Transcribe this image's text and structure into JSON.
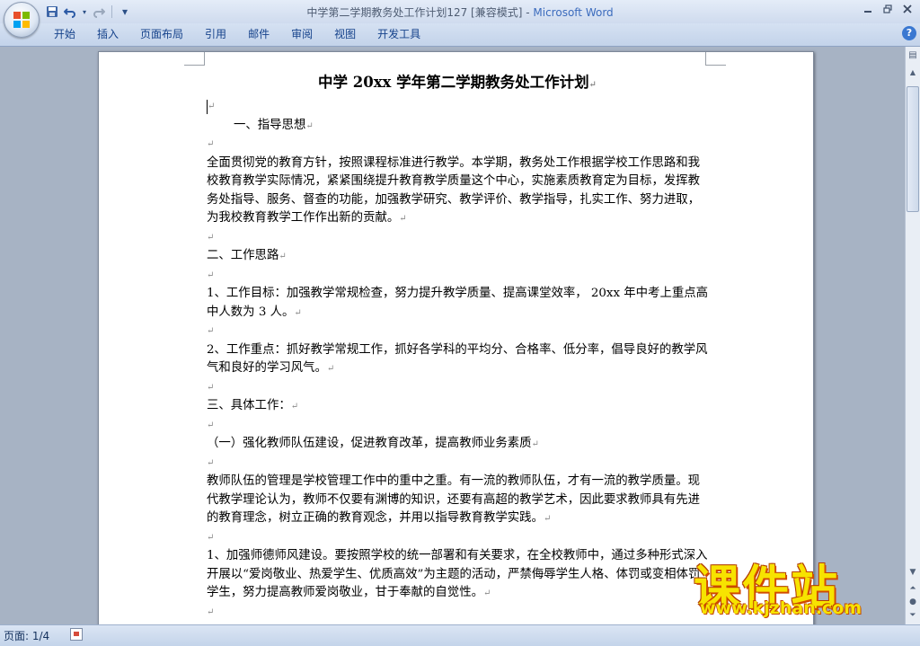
{
  "window": {
    "title_doc": "中学第二学期教务处工作计划127 [兼容模式]",
    "title_sep": " - ",
    "title_app": "Microsoft Word"
  },
  "quick_access": {
    "icons": [
      "save-icon",
      "undo-icon",
      "redo-icon",
      "customize-icon"
    ],
    "customize_glyph": "▾"
  },
  "ribbon": {
    "tabs": [
      "开始",
      "插入",
      "页面布局",
      "引用",
      "邮件",
      "审阅",
      "视图",
      "开发工具"
    ],
    "help_label": "?"
  },
  "document": {
    "title": "中学 20xx 学年第二学期教务处工作计划",
    "paragraph_mark": "↵",
    "paragraphs": [
      {
        "type": "cursor",
        "text": ""
      },
      {
        "type": "text",
        "indent": true,
        "text": "一、指导思想"
      },
      {
        "type": "empty",
        "text": ""
      },
      {
        "type": "text",
        "indent": false,
        "text": "全面贯彻党的教育方针，按照课程标准进行教学。本学期，教务处工作根据学校工作思路和我校教育教学实际情况，紧紧围绕提升教育教学质量这个中心，实施素质教育定为目标，发挥教务处指导、服务、督查的功能，加强教学研究、教学评价、教学指导，扎实工作、努力进取，为我校教育教学工作作出新的贡献。"
      },
      {
        "type": "empty",
        "text": ""
      },
      {
        "type": "text",
        "indent": false,
        "text": "二、工作思路"
      },
      {
        "type": "empty",
        "text": ""
      },
      {
        "type": "text",
        "indent": false,
        "text": "1、工作目标：加强教学常规检查，努力提升教学质量、提高课堂效率， 20xx 年中考上重点高中人数为 3 人。"
      },
      {
        "type": "empty",
        "text": ""
      },
      {
        "type": "text",
        "indent": false,
        "text": "2、工作重点：抓好教学常规工作，抓好各学科的平均分、合格率、低分率，倡导良好的教学风气和良好的学习风气。"
      },
      {
        "type": "empty",
        "text": ""
      },
      {
        "type": "text",
        "indent": false,
        "text": "三、具体工作："
      },
      {
        "type": "empty",
        "text": ""
      },
      {
        "type": "text",
        "indent": false,
        "text": "（一）强化教师队伍建设，促进教育改革，提高教师业务素质"
      },
      {
        "type": "empty",
        "text": ""
      },
      {
        "type": "text",
        "indent": false,
        "text": "教师队伍的管理是学校管理工作中的重中之重。有一流的教师队伍，才有一流的教学质量。现代教学理论认为，教师不仅要有渊博的知识，还要有高超的教学艺术，因此要求教师具有先进的教育理念，树立正确的教育观念，并用以指导教育教学实践。"
      },
      {
        "type": "empty",
        "text": ""
      },
      {
        "type": "text",
        "indent": false,
        "text": "1、加强师德师风建设。要按照学校的统一部署和有关要求，在全校教师中，通过多种形式深入开展以“爱岗敬业、热爱学生、优质高效”为主题的活动，严禁侮辱学生人格、体罚或变相体罚学生，努力提高教师爱岗敬业，甘于奉献的自觉性。"
      },
      {
        "type": "empty",
        "text": ""
      }
    ]
  },
  "statusbar": {
    "page_label": "页面: 1/4"
  },
  "watermark": {
    "main": "课件站",
    "url": "www.kjzhan.com"
  },
  "colors": {
    "title_app": "#3b6bbd",
    "tab_text": "#15428b",
    "workspace": "#a7b3c4",
    "watermark_fill": "#f7e300",
    "watermark_outline": "#c44700"
  }
}
